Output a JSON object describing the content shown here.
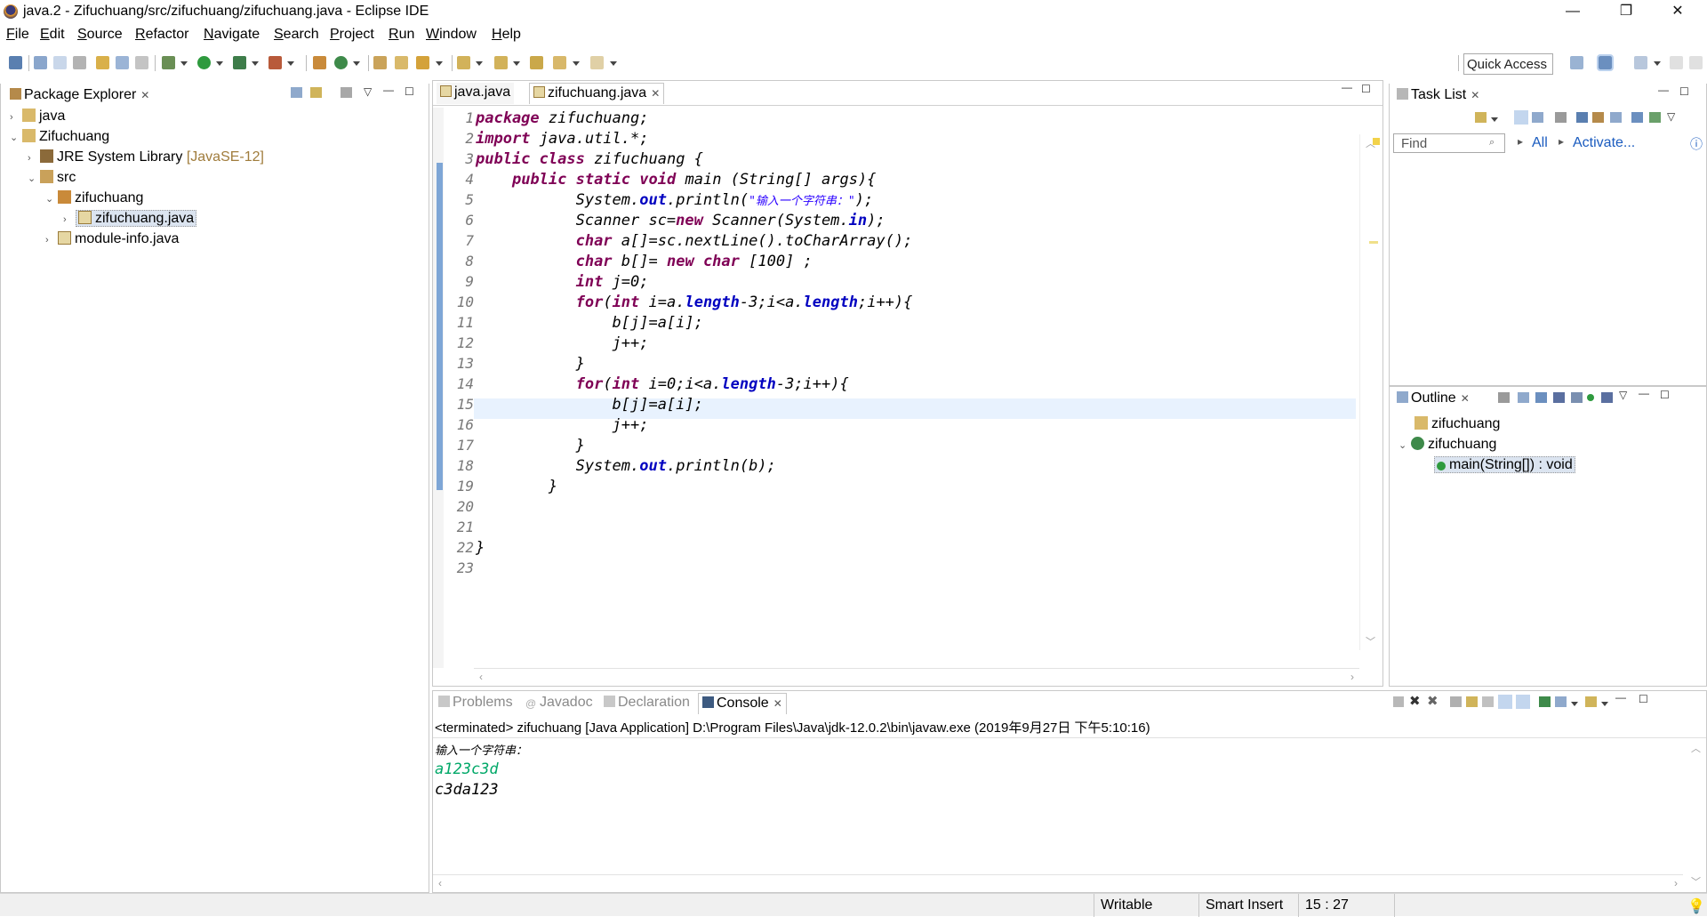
{
  "window": {
    "title": "java.2 - Zifuchuang/src/zifuchuang/zifuchuang.java - Eclipse IDE",
    "minimize": "—",
    "restore": "❐",
    "close": "✕"
  },
  "menu": [
    "File",
    "Edit",
    "Source",
    "Refactor",
    "Navigate",
    "Search",
    "Project",
    "Run",
    "Window",
    "Help"
  ],
  "toolbar": {
    "quick_access": "Quick Access"
  },
  "package_explorer": {
    "tab_label": "Package Explorer",
    "tree": [
      {
        "label": "java",
        "suffix": ""
      },
      {
        "label": "Zifuchuang",
        "suffix": ""
      },
      {
        "label": "JRE System Library",
        "suffix": "[JavaSE-12]"
      },
      {
        "label": "src",
        "suffix": ""
      },
      {
        "label": "zifuchuang",
        "suffix": ""
      },
      {
        "label": "zifuchuang.java",
        "suffix": ""
      },
      {
        "label": "module-info.java",
        "suffix": ""
      }
    ]
  },
  "editor": {
    "tabs": [
      "java.java",
      "zifuchuang.java"
    ],
    "line_numbers": [
      "1",
      "2",
      "3",
      "4",
      "5",
      "6",
      "7",
      "8",
      "9",
      "10",
      "11",
      "12",
      "13",
      "14",
      "15",
      "16",
      "17",
      "18",
      "19",
      "20",
      "21",
      "22",
      "23"
    ],
    "code_lines": [
      "package zifuchuang;",
      "import java.util.*;",
      "public class zifuchuang {",
      "    public static void main (String[] args){",
      "           System.out.println(\"输入一个字符串：\");",
      "           Scanner sc=new Scanner(System.in);",
      "           char a[]=sc.nextLine().toCharArray();",
      "           char b[]= new char [100] ;",
      "           int j=0;",
      "           for(int i=a.length-3;i<a.length;i++){",
      "               b[j]=a[i];",
      "               j++;",
      "           }",
      "           for(int i=0;i<a.length-3;i++){",
      "               b[j]=a[i];",
      "               j++;",
      "           }",
      "           System.out.println(b);",
      "        }",
      "",
      "",
      "}",
      ""
    ]
  },
  "task_list": {
    "tab_label": "Task List",
    "find_placeholder": "Find",
    "all": "All",
    "activate": "Activate..."
  },
  "outline": {
    "tab_label": "Outline",
    "items": [
      "zifuchuang",
      "zifuchuang",
      "main(String[]) : void"
    ]
  },
  "console": {
    "tabs": [
      "Problems",
      "Javadoc",
      "Declaration",
      "Console"
    ],
    "header": "<terminated> zifuchuang [Java Application] D:\\Program Files\\Java\\jdk-12.0.2\\bin\\javaw.exe (2019年9月27日 下午5:10:16)",
    "lines": [
      "输入一个字符串：",
      "a123c3d",
      "c3da123"
    ]
  },
  "status": {
    "writable": "Writable",
    "insert_mode": "Smart Insert",
    "position": "15 : 27"
  },
  "colors": {
    "keyword": "#7f0055",
    "field": "#0000c0",
    "string": "#2a00ff",
    "input": "#00a868",
    "link": "#1a5bbf"
  }
}
